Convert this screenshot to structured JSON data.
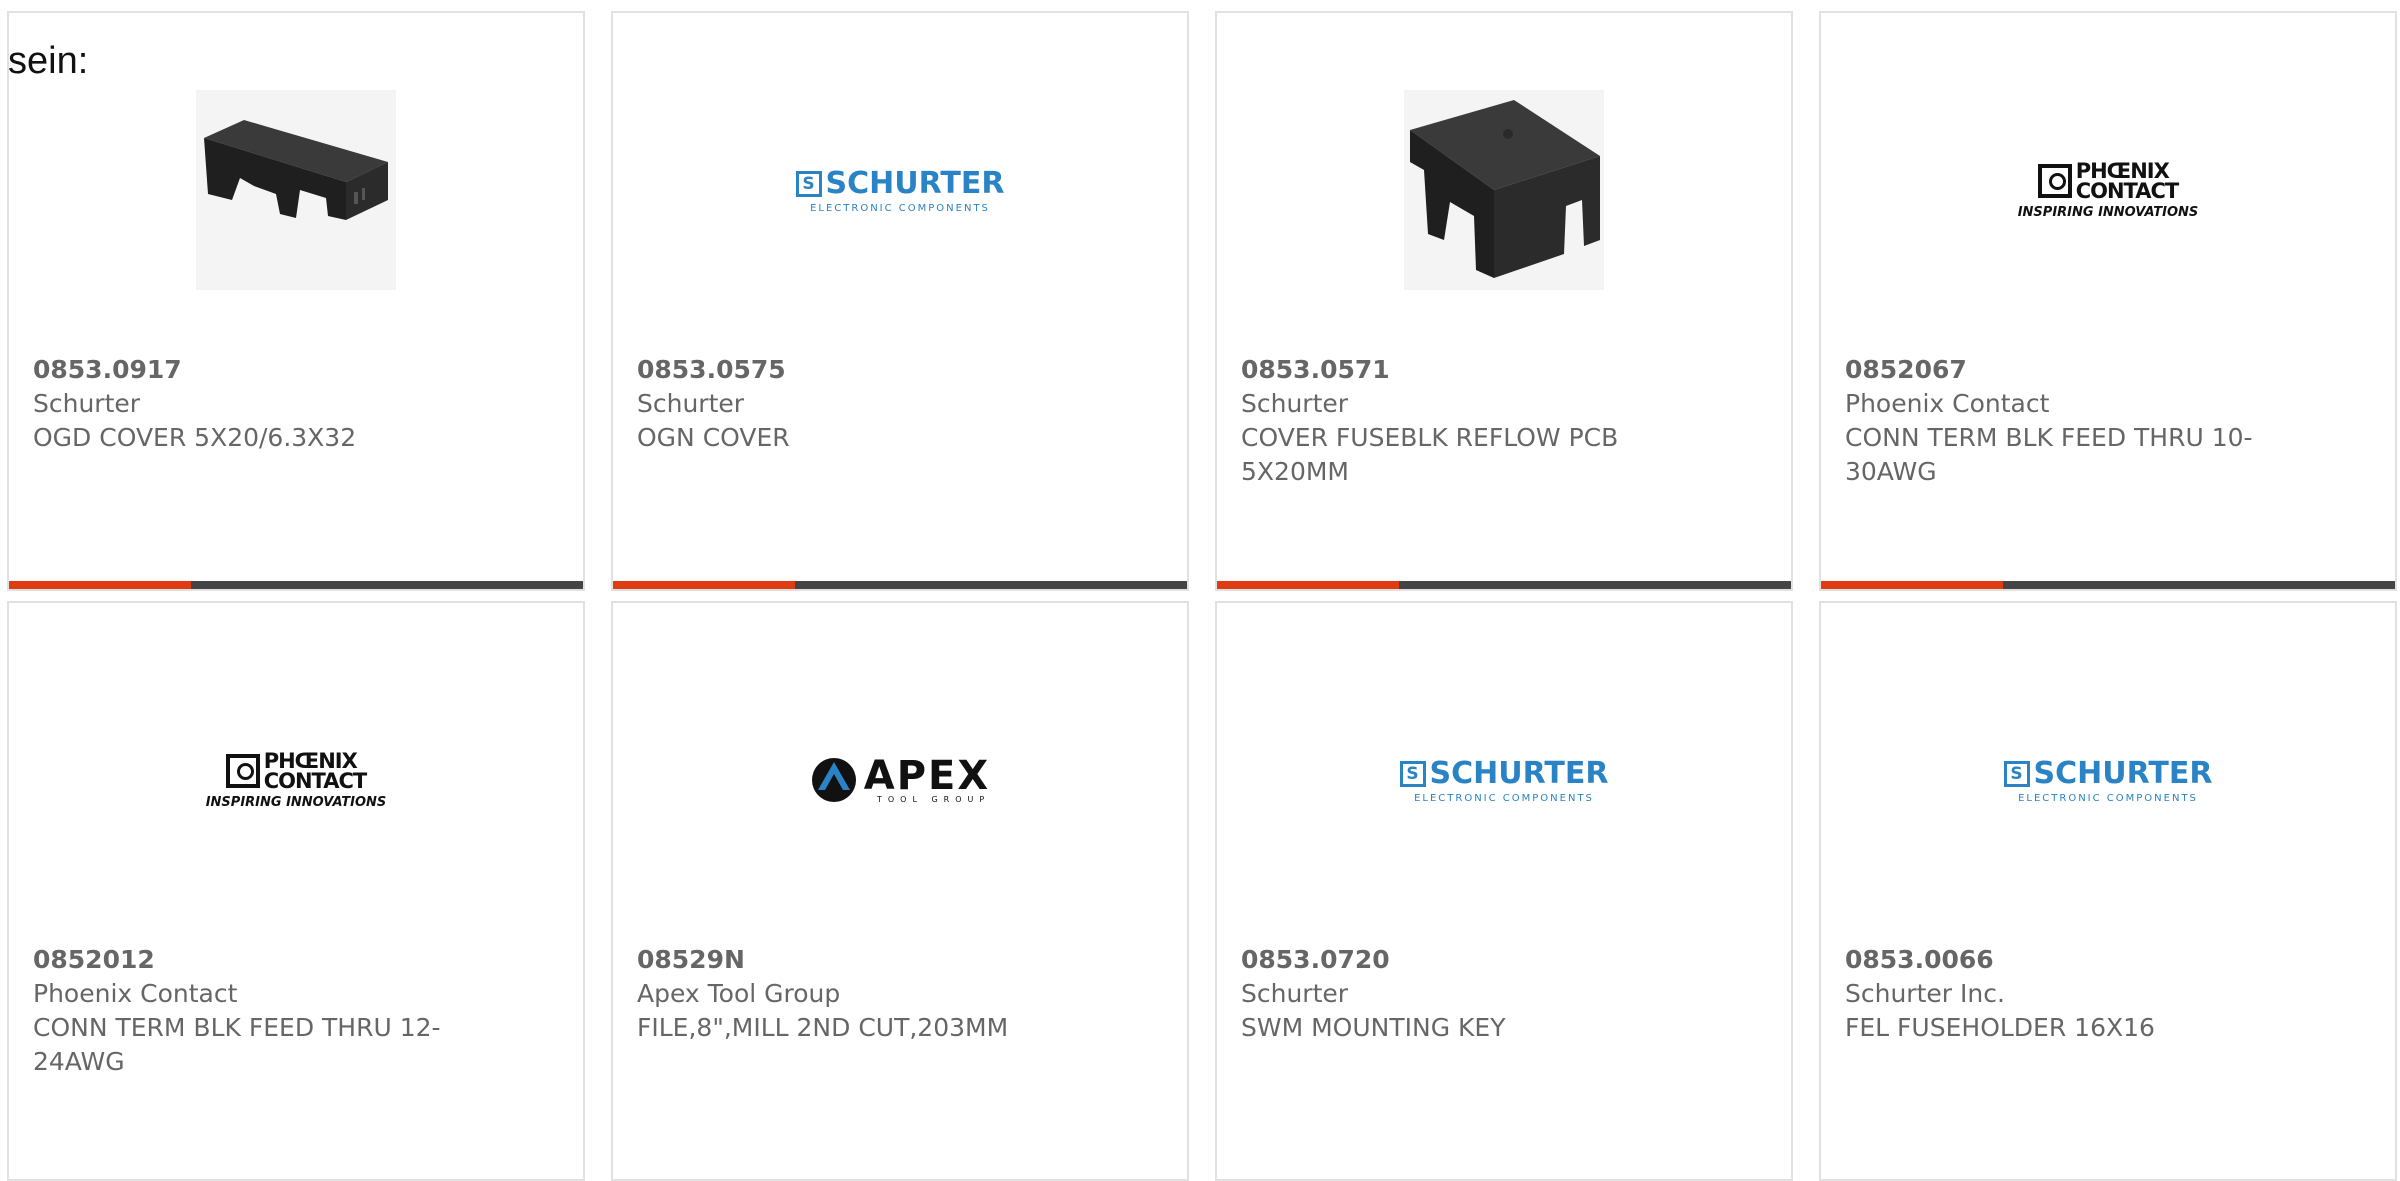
{
  "intro": "sein:",
  "brand_colors": {
    "accent_bar": "#e03c14",
    "bar_dark": "#444444",
    "schurter_blue": "#2a83c4"
  },
  "products": [
    {
      "part_number": "0853.0917",
      "manufacturer": "Schurter",
      "description": "OGD COVER 5X20/6.3X32",
      "image": "product-photo-cover"
    },
    {
      "part_number": "0853.0575",
      "manufacturer": "Schurter",
      "description": "OGN COVER",
      "image": "schurter-logo",
      "logo": {
        "word": "SCHURTER",
        "mark": "S",
        "sub": "ELECTRONIC COMPONENTS"
      }
    },
    {
      "part_number": "0853.0571",
      "manufacturer": "Schurter",
      "description": "COVER FUSEBLK REFLOW PCB 5X20MM",
      "image": "product-photo-cover-block"
    },
    {
      "part_number": "0852067",
      "manufacturer": "Phoenix Contact",
      "description": "CONN TERM BLK FEED THRU 10-30AWG",
      "image": "phoenix-logo",
      "logo": {
        "line1": "PHŒNIX",
        "line2": "CONTACT",
        "sub": "INSPIRING INNOVATIONS"
      }
    },
    {
      "part_number": "0852012",
      "manufacturer": "Phoenix Contact",
      "description": "CONN TERM BLK FEED THRU 12-24AWG",
      "image": "phoenix-logo",
      "logo": {
        "line1": "PHŒNIX",
        "line2": "CONTACT",
        "sub": "INSPIRING INNOVATIONS"
      }
    },
    {
      "part_number": "08529N",
      "manufacturer": "Apex Tool Group",
      "description": "FILE,8\",MILL 2ND CUT,203MM",
      "image": "apex-logo",
      "logo": {
        "word": "APEX",
        "sub": "TOOL GROUP"
      }
    },
    {
      "part_number": "0853.0720",
      "manufacturer": "Schurter",
      "description": "SWM MOUNTING KEY",
      "image": "schurter-logo",
      "logo": {
        "word": "SCHURTER",
        "mark": "S",
        "sub": "ELECTRONIC COMPONENTS"
      }
    },
    {
      "part_number": "0853.0066",
      "manufacturer": "Schurter Inc.",
      "description": "FEL FUSEHOLDER 16X16",
      "image": "schurter-logo",
      "logo": {
        "word": "SCHURTER",
        "mark": "S",
        "sub": "ELECTRONIC COMPONENTS"
      }
    }
  ]
}
